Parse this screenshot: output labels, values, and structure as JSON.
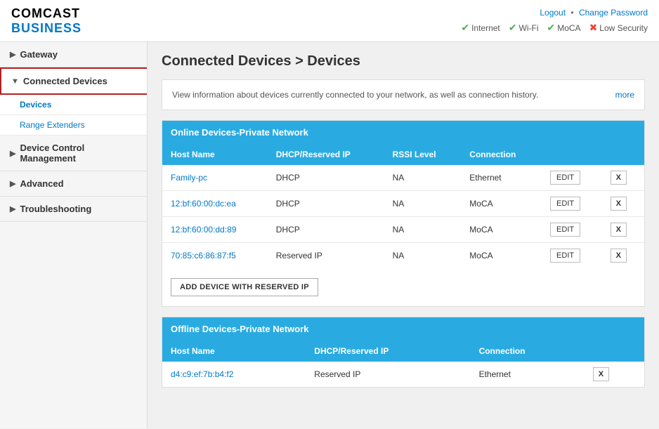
{
  "header": {
    "logo_comcast": "COMCAST",
    "logo_business": "BUSINESS",
    "links": {
      "logout": "Logout",
      "separator": "•",
      "change_password": "Change Password"
    },
    "status": [
      {
        "id": "internet",
        "label": "Internet",
        "ok": true
      },
      {
        "id": "wifi",
        "label": "Wi-Fi",
        "ok": true
      },
      {
        "id": "moca",
        "label": "MoCA",
        "ok": true
      },
      {
        "id": "security",
        "label": "Low Security",
        "ok": false
      }
    ]
  },
  "sidebar": {
    "items": [
      {
        "id": "gateway",
        "label": "Gateway",
        "arrow": "▶",
        "active": false,
        "sub": []
      },
      {
        "id": "connected-devices",
        "label": "Connected Devices",
        "arrow": "▼",
        "active": true,
        "sub": [
          {
            "id": "devices",
            "label": "Devices",
            "active": true
          },
          {
            "id": "range-extenders",
            "label": "Range Extenders",
            "active": false
          }
        ]
      },
      {
        "id": "device-control",
        "label": "Device Control Management",
        "arrow": "▶",
        "active": false,
        "sub": []
      },
      {
        "id": "advanced",
        "label": "Advanced",
        "arrow": "▶",
        "active": false,
        "sub": []
      },
      {
        "id": "troubleshooting",
        "label": "Troubleshooting",
        "arrow": "▶",
        "active": false,
        "sub": []
      }
    ]
  },
  "page": {
    "title": "Connected Devices > Devices",
    "info_text": "View information about devices currently connected to your network, as well as connection history.",
    "more_link": "more"
  },
  "online_table": {
    "header": "Online Devices-Private Network",
    "columns": [
      "Host Name",
      "DHCP/Reserved IP",
      "RSSI Level",
      "Connection"
    ],
    "rows": [
      {
        "host": "Family-pc",
        "ip": "DHCP",
        "rssi": "NA",
        "connection": "Ethernet"
      },
      {
        "host": "12:bf:60:00:dc:ea",
        "ip": "DHCP",
        "rssi": "NA",
        "connection": "MoCA"
      },
      {
        "host": "12:bf:60:00:dd:89",
        "ip": "DHCP",
        "rssi": "NA",
        "connection": "MoCA"
      },
      {
        "host": "70:85:c6:86:87:f5",
        "ip": "Reserved IP",
        "rssi": "NA",
        "connection": "MoCA"
      }
    ],
    "add_button": "ADD DEVICE WITH RESERVED IP"
  },
  "offline_table": {
    "header": "Offline Devices-Private Network",
    "columns": [
      "Host Name",
      "DHCP/Reserved IP",
      "Connection"
    ],
    "rows": [
      {
        "host": "d4:c9:ef:7b:b4:f2",
        "ip": "Reserved IP",
        "connection": "Ethernet"
      }
    ]
  },
  "buttons": {
    "edit": "EDIT",
    "remove": "X"
  }
}
